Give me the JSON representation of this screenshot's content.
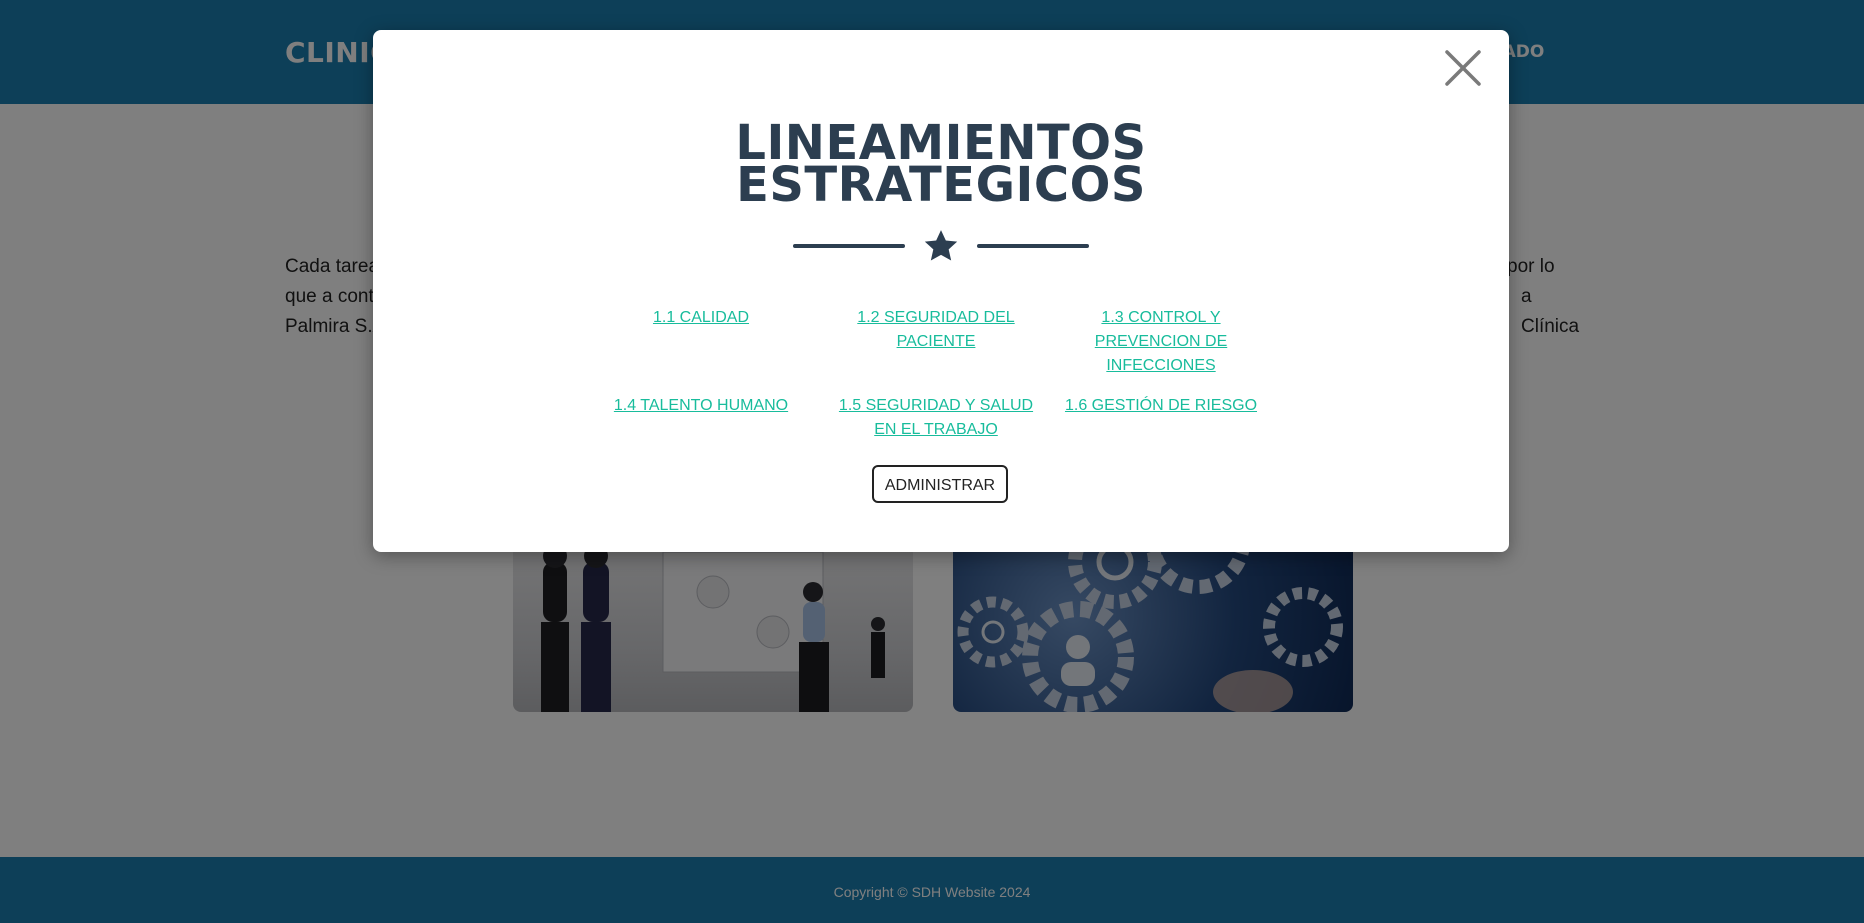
{
  "navbar": {
    "brand": "CLINIC",
    "nav_link": "RTADO"
  },
  "background_text": "Cada tarea... que a cont... Palmira S.A... por lo ... a Clínica",
  "body_text_lines": [
    "Cada tarea",
    "que a cont",
    "Palmira S.A"
  ],
  "body_text_right": [
    "por lo",
    "a Clínica"
  ],
  "modal": {
    "title_line1": "LINEAMIENTOS",
    "title_line2": "ESTRATEGICOS",
    "divider_icon": "star-icon",
    "close_icon": "close-icon",
    "links": [
      "1.1 CALIDAD",
      "1.2 SEGURIDAD DEL PACIENTE",
      "1.3 CONTROL Y PREVENCION DE INFECCIONES",
      "1.4 TALENTO HUMANO",
      "1.5 SEGURIDAD Y SALUD EN EL TRABAJO",
      "1.6 GESTIÓN DE RIESGO"
    ],
    "admin_button": "ADMINISTRAR"
  },
  "footer": {
    "copyright": "Copyright © SDH Website 2024"
  },
  "colors": {
    "navbar": "#1a7fb1",
    "modal_title": "#2c3e50",
    "link": "#18bc9c",
    "backdrop": "rgba(0,0,0,0.5)"
  }
}
